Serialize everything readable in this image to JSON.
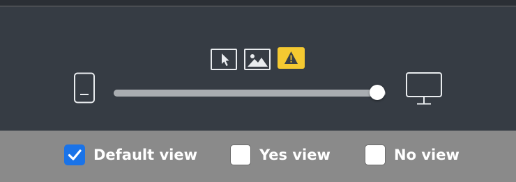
{
  "toolbar": {
    "icons": [
      {
        "name": "pointer-icon"
      },
      {
        "name": "image-icon"
      },
      {
        "name": "warning-icon",
        "color": "#f5c931"
      }
    ]
  },
  "viewport_slider": {
    "min_label_icon": "mobile-phone-icon",
    "max_label_icon": "desktop-monitor-icon",
    "value_fraction": 1.0
  },
  "view_options": [
    {
      "label": "Default view",
      "checked": true
    },
    {
      "label": "Yes view",
      "checked": false
    },
    {
      "label": "No view",
      "checked": false
    }
  ],
  "colors": {
    "panel_bg": "#363c44",
    "bottom_bar_bg": "#8a8a8a",
    "checkbox_checked": "#1a73e8",
    "warning": "#f5c931"
  }
}
